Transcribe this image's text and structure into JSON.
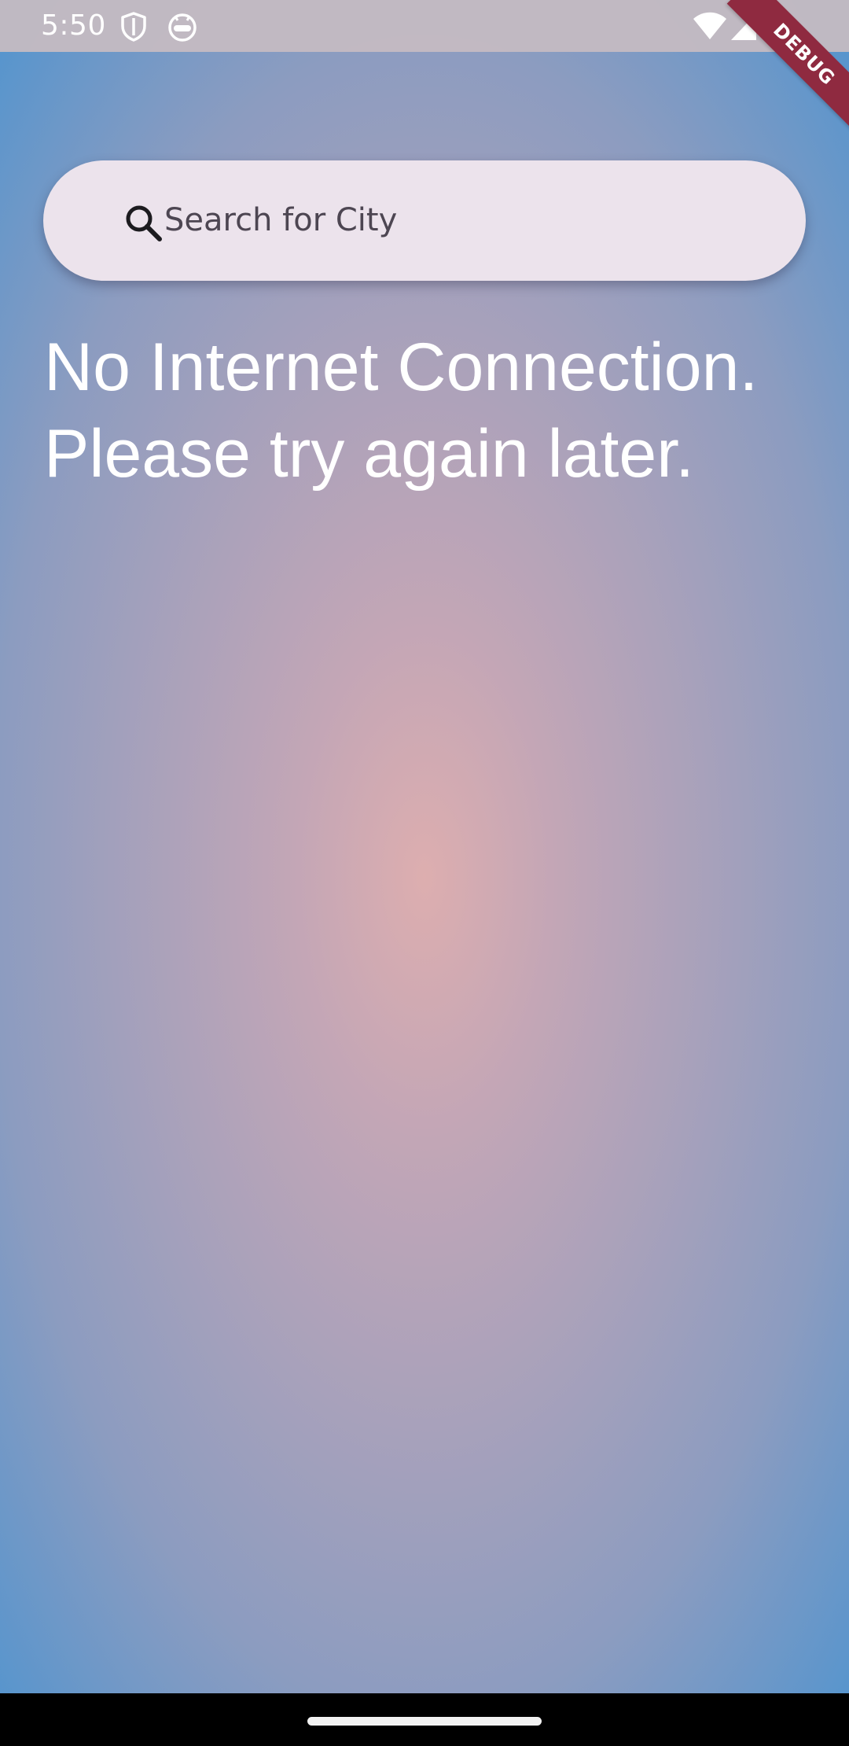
{
  "status_bar": {
    "time": "5:50",
    "icons": [
      "shield-icon",
      "android-face-icon",
      "wifi-icon",
      "signal-icon"
    ]
  },
  "debug_banner": {
    "label": "DEBUG",
    "color": "#8f2a40"
  },
  "search": {
    "placeholder": "Search for City",
    "value": "",
    "icon": "search-icon"
  },
  "message": {
    "line1": "No Internet Connection.",
    "line2": "Please try again later."
  },
  "theme": {
    "gradient_center": "#ddaeaf",
    "gradient_edge": "#5895cd",
    "search_bg": "#ece3ec"
  }
}
